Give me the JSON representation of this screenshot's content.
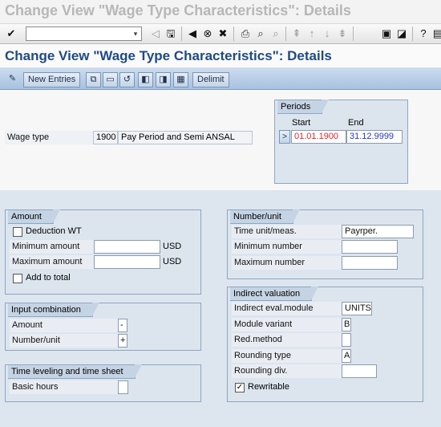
{
  "window_title": "Change View \"Wage Type Characteristics\": Details",
  "screen_title": "Change View \"Wage Type Characteristics\": Details",
  "toolbar": {
    "new_entries_label": "New Entries",
    "delimit_label": "Delimit"
  },
  "wage_type": {
    "label": "Wage type",
    "code": "1900",
    "text": "Pay Period and Semi ANSAL"
  },
  "periods": {
    "title": "Periods",
    "start_label": "Start",
    "end_label": "End",
    "button_label": ">",
    "start_value": "01.01.1900",
    "end_value": "31.12.9999"
  },
  "amount": {
    "title": "Amount",
    "deduction_label": "Deduction WT",
    "deduction_checked": false,
    "minimum_label": "Minimum amount",
    "minimum_value": "",
    "minimum_currency": "USD",
    "maximum_label": "Maximum amount",
    "maximum_value": "",
    "maximum_currency": "USD",
    "add_to_total_label": "Add to total",
    "add_to_total_checked": false
  },
  "input_combination": {
    "title": "Input combination",
    "amount_label": "Amount",
    "amount_value": "-",
    "number_label": "Number/unit",
    "number_value": "+"
  },
  "time_leveling": {
    "title": "Time leveling and time sheet",
    "basic_hours_label": "Basic hours",
    "basic_hours_value": ""
  },
  "number_unit": {
    "title": "Number/unit",
    "time_unit_label": "Time unit/meas.",
    "time_unit_value": "Payrper.",
    "min_number_label": "Minimum number",
    "min_number_value": "",
    "max_number_label": "Maximum number",
    "max_number_value": ""
  },
  "indirect_valuation": {
    "title": "Indirect valuation",
    "module_label": "Indirect eval.module",
    "module_value": "UNITS",
    "variant_label": "Module variant",
    "variant_value": "B",
    "red_method_label": "Red.method",
    "red_method_value": "",
    "rounding_type_label": "Rounding type",
    "rounding_type_value": "A",
    "rounding_div_label": "Rounding div.",
    "rounding_div_value": "",
    "rewritable_label": "Rewritable",
    "rewritable_checked": true
  },
  "colors": {
    "title_blue": "#1f4b82",
    "start_date_red": "#e0282a",
    "end_date_blue": "#2b36c8"
  }
}
